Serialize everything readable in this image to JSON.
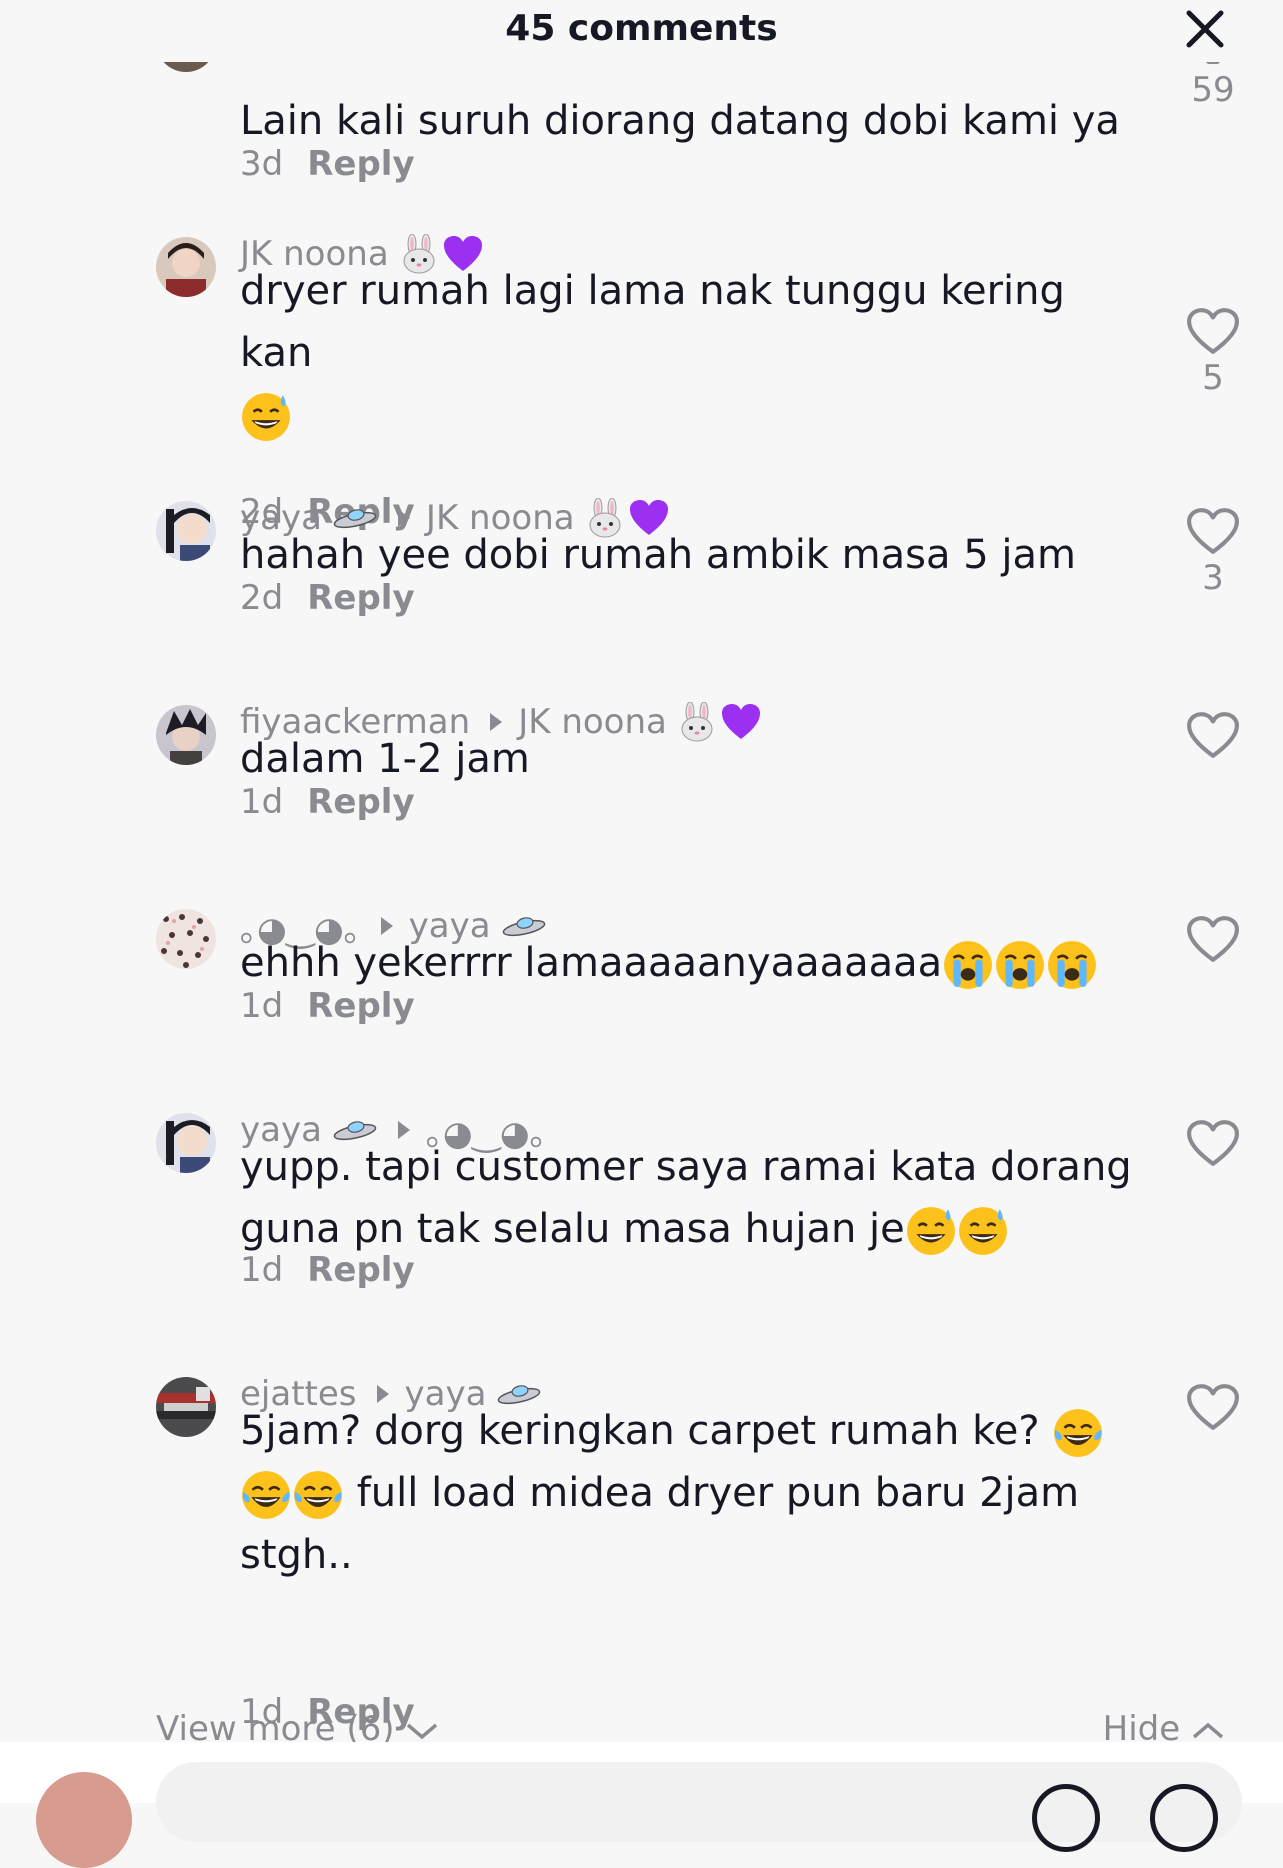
{
  "header": {
    "title": "45 comments"
  },
  "comments": [
    {
      "author": "",
      "text": "Lain kali suruh diorang datang dobi kami ya",
      "age": "3d",
      "reply": "Reply",
      "likes": "59"
    },
    {
      "author": "JK noona",
      "text": "dryer rumah lagi lama nak tunggu kering kan",
      "age": "2d",
      "reply": "Reply",
      "likes": "5"
    },
    {
      "author": "yaya",
      "reply_to": "JK noona",
      "text": "hahah yee dobi rumah ambik masa 5 jam",
      "age": "2d",
      "reply": "Reply",
      "likes": "3"
    },
    {
      "author": "fiyaackerman",
      "reply_to": "JK noona",
      "text": "dalam 1-2 jam",
      "age": "1d",
      "reply": "Reply",
      "likes": ""
    },
    {
      "author": "｡◕‿◕｡",
      "reply_to": "yaya",
      "text": "ehhh yekerrrr lamaaaaanyaaaaaaa",
      "age": "1d",
      "reply": "Reply",
      "likes": ""
    },
    {
      "author": "yaya",
      "reply_to": "｡◕‿◕｡",
      "text": "yupp. tapi customer saya ramai kata dorang\nguna pn tak selalu masa hujan je",
      "age": "1d",
      "reply": "Reply",
      "likes": ""
    },
    {
      "author": "ejattes",
      "reply_to": "yaya",
      "text": "5jam? dorg keringkan carpet rumah ke?",
      "text2": "full load midea dryer pun baru 2jam",
      "text3": "stgh..",
      "age": "1d",
      "reply": "Reply",
      "likes": ""
    }
  ],
  "footer": {
    "view_more": "View more (6)",
    "hide": "Hide"
  },
  "icons": [
    "close-icon",
    "heart-icon",
    "rabbit-emoji",
    "purple-heart-emoji",
    "ufo-emoji",
    "sweat-smile-emoji",
    "crying-emoji",
    "tears-of-joy-emoji",
    "chevron-down-icon",
    "chevron-up-icon"
  ],
  "colors": {
    "background": "#f7f7f8",
    "text": "#161823",
    "muted": "#8a8b91"
  }
}
